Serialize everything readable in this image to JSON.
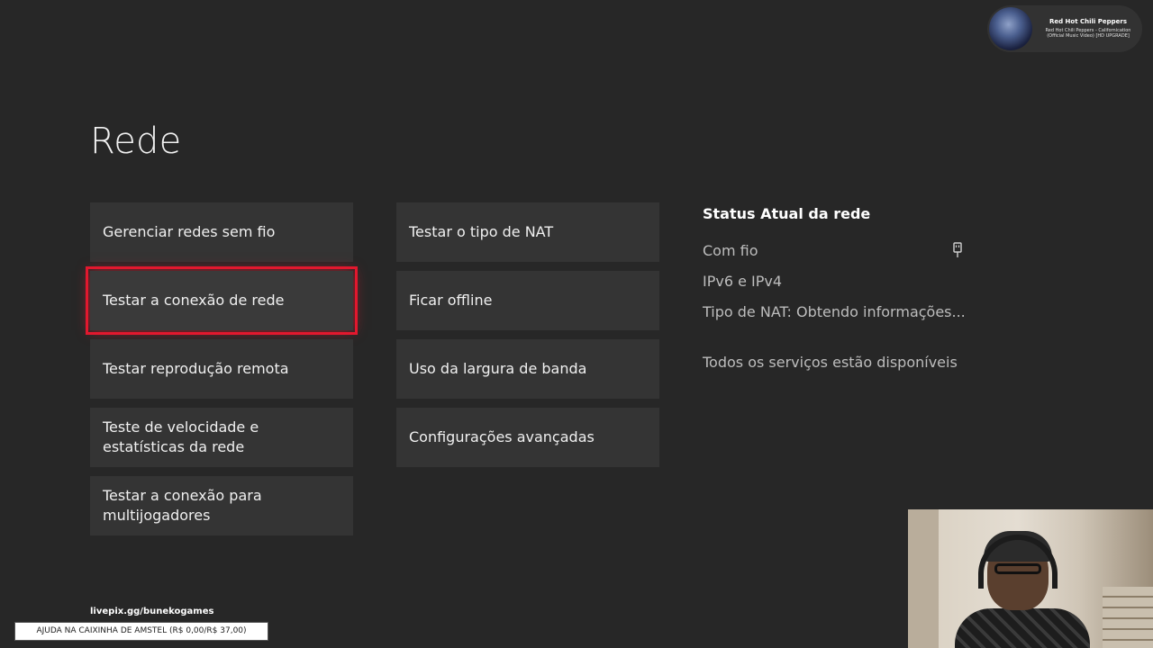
{
  "page": {
    "title": "Rede"
  },
  "menu_left": [
    {
      "label": "Gerenciar redes sem fio"
    },
    {
      "label": "Testar a conexão de rede"
    },
    {
      "label": "Testar reprodução remota"
    },
    {
      "label": "Teste de velocidade e estatísticas da rede"
    },
    {
      "label": "Testar a conexão para multijogadores"
    }
  ],
  "menu_right": [
    {
      "label": "Testar o tipo de NAT"
    },
    {
      "label": "Ficar offline"
    },
    {
      "label": "Uso da largura de banda"
    },
    {
      "label": "Configurações avançadas"
    }
  ],
  "focused_item": "Testar a conexão de rede",
  "status": {
    "heading": "Status Atual da rede",
    "connection": "Com fio",
    "connection_icon": "ethernet-plug-icon",
    "ip": "IPv6 e IPv4",
    "nat": "Tipo de NAT: Obtendo informações...",
    "services": "Todos os serviços estão disponíveis"
  },
  "now_playing": {
    "artist": "Red Hot Chili Peppers",
    "track": "Red Hot Chili Peppers - Californication (Official Music Video) [HD UPGRADE]"
  },
  "overlay": {
    "donation_url": "livepix.gg/bunekogames",
    "goal": "AJUDA NA CAIXINHA DE AMSTEL (R$ 0,00/R$ 37,00)"
  },
  "colors": {
    "background": "#272727",
    "tile": "#343434",
    "focus": "#e2182e",
    "status_text": "#bdbdbd"
  }
}
